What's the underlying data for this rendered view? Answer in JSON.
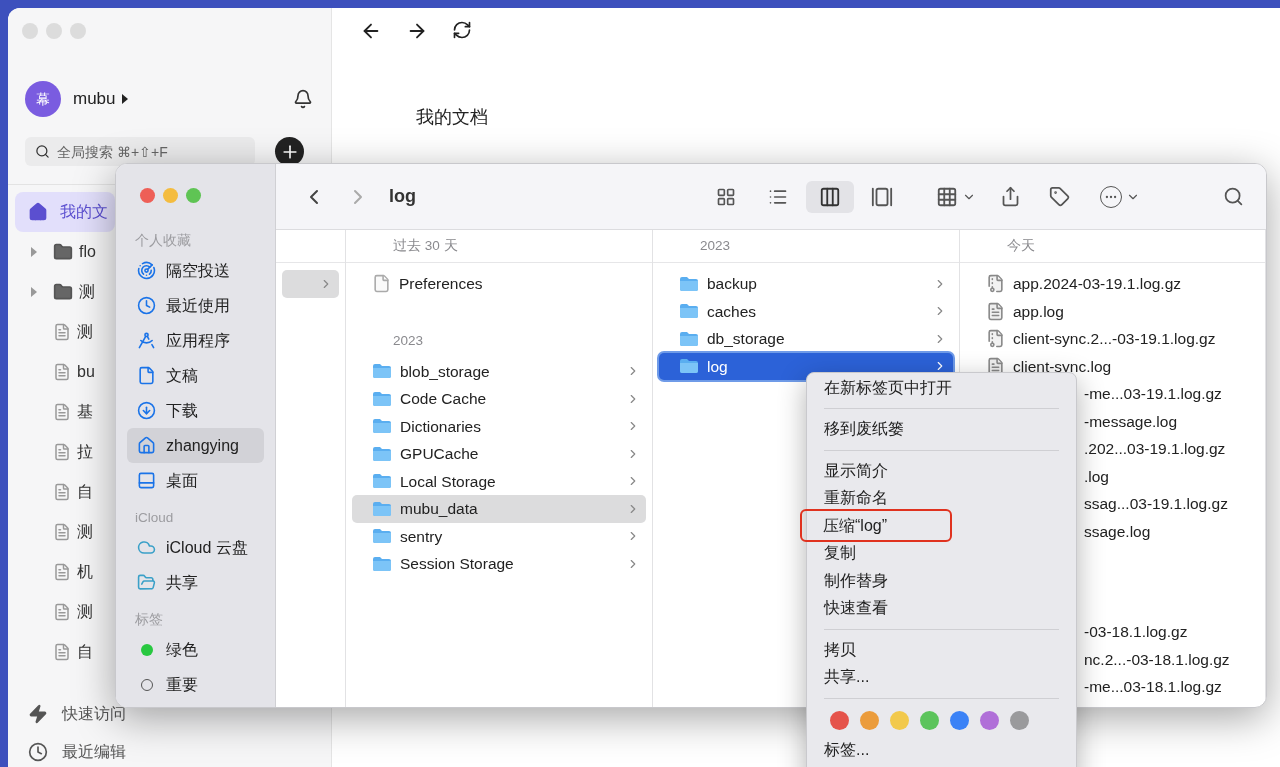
{
  "mubu": {
    "user": {
      "avatar": "幕",
      "name": "mubu"
    },
    "search": {
      "placeholder": "全局搜索 ⌘+⇧+F"
    },
    "sidebar": [
      {
        "label": "我的文",
        "kind": "home",
        "selected": true
      },
      {
        "label": "flo",
        "kind": "folder",
        "selected": false
      },
      {
        "label": "测",
        "kind": "folder",
        "selected": false
      },
      {
        "label": "测",
        "kind": "doc",
        "selected": false
      },
      {
        "label": "bu",
        "kind": "doc",
        "selected": false
      },
      {
        "label": "基",
        "kind": "doc",
        "selected": false
      },
      {
        "label": "拉",
        "kind": "doc",
        "selected": false
      },
      {
        "label": "自",
        "kind": "doc",
        "selected": false
      },
      {
        "label": "测",
        "kind": "doc",
        "selected": false
      },
      {
        "label": "机",
        "kind": "doc",
        "selected": false
      },
      {
        "label": "测",
        "kind": "doc",
        "selected": false
      },
      {
        "label": "自",
        "kind": "doc",
        "selected": false
      }
    ],
    "links": [
      {
        "label": "快速访问",
        "kind": "bolt"
      },
      {
        "label": "最近编辑",
        "kind": "clock"
      }
    ],
    "page_title": "我的文档"
  },
  "finder": {
    "title": "log",
    "view_modes": [
      {
        "kind": "icons",
        "selected": false
      },
      {
        "kind": "list",
        "selected": false
      },
      {
        "kind": "columns",
        "selected": true
      },
      {
        "kind": "gallery",
        "selected": false
      }
    ],
    "sidebar": [
      {
        "heading": "个人收藏",
        "items": [
          {
            "label": "隔空投送",
            "kind": "airdrop",
            "selected": false
          },
          {
            "label": "最近使用",
            "kind": "recents",
            "selected": false
          },
          {
            "label": "应用程序",
            "kind": "apps",
            "selected": false
          },
          {
            "label": "文稿",
            "kind": "documents",
            "selected": false
          },
          {
            "label": "下载",
            "kind": "downloads",
            "selected": false
          },
          {
            "label": "zhangying",
            "kind": "home",
            "selected": true
          },
          {
            "label": "桌面",
            "kind": "desktop",
            "selected": false
          }
        ]
      },
      {
        "heading": "iCloud",
        "items": [
          {
            "label": "iCloud 云盘",
            "kind": "cloud",
            "selected": false
          },
          {
            "label": "共享",
            "kind": "shared",
            "selected": false
          }
        ]
      },
      {
        "heading": "标签",
        "items": [
          {
            "label": "绿色",
            "kind": "tag",
            "color": "#28c840",
            "selected": false
          },
          {
            "label": "重要",
            "kind": "tag_empty",
            "selected": false
          }
        ]
      }
    ],
    "columns": [
      {
        "focused": false,
        "groups": [
          {
            "rows": [
              {
                "kind": "hidden",
                "selected": true,
                "chevron": true
              }
            ]
          }
        ]
      },
      {
        "header": "过去 30 天",
        "focused": false,
        "groups": [
          {
            "rows": [
              {
                "label": "Preferences",
                "kind": "document",
                "selected": false,
                "chevron": false
              }
            ]
          },
          {
            "header": "2023",
            "rows": [
              {
                "label": "blob_storage",
                "kind": "folder",
                "selected": false,
                "chevron": true
              },
              {
                "label": "Code Cache",
                "kind": "folder",
                "selected": false,
                "chevron": true
              },
              {
                "label": "Dictionaries",
                "kind": "folder",
                "selected": false,
                "chevron": true
              },
              {
                "label": "GPUCache",
                "kind": "folder",
                "selected": false,
                "chevron": true
              },
              {
                "label": "Local Storage",
                "kind": "folder",
                "selected": false,
                "chevron": true
              },
              {
                "label": "mubu_data",
                "kind": "folder",
                "selected": true,
                "chevron": true
              },
              {
                "label": "sentry",
                "kind": "folder",
                "selected": false,
                "chevron": true
              },
              {
                "label": "Session Storage",
                "kind": "folder",
                "selected": false,
                "chevron": true
              }
            ]
          }
        ]
      },
      {
        "header": "2023",
        "focused": true,
        "groups": [
          {
            "rows": [
              {
                "label": "backup",
                "kind": "folder",
                "selected": false,
                "chevron": true
              },
              {
                "label": "caches",
                "kind": "folder",
                "selected": false,
                "chevron": true
              },
              {
                "label": "db_storage",
                "kind": "folder",
                "selected": false,
                "chevron": true
              },
              {
                "label": "log",
                "kind": "folder",
                "selected": true,
                "chevron": true
              }
            ]
          }
        ]
      },
      {
        "header": "今天",
        "groups": [
          {
            "rows": [
              {
                "label": "app.2024-03-19.1.log.gz",
                "kind": "archive",
                "selected": false,
                "chevron": false
              },
              {
                "label": "app.log",
                "kind": "log",
                "selected": false,
                "chevron": false
              },
              {
                "label": "client-sync.2...-03-19.1.log.gz",
                "kind": "archive",
                "selected": false,
                "chevron": false
              },
              {
                "label": "client-sync.log",
                "kind": "log",
                "selected": false,
                "chevron": false
              },
              {
                "label": "-me...03-19.1.log.gz",
                "kind": "fragment",
                "selected": false,
                "chevron": false
              },
              {
                "label": "-message.log",
                "kind": "fragment",
                "selected": false,
                "chevron": false
              },
              {
                "label": ".202...03-19.1.log.gz",
                "kind": "fragment",
                "selected": false,
                "chevron": false
              },
              {
                "label": ".log",
                "kind": "fragment",
                "selected": false,
                "chevron": false
              },
              {
                "label": "ssag...03-19.1.log.gz",
                "kind": "fragment",
                "selected": false,
                "chevron": false
              },
              {
                "label": "ssage.log",
                "kind": "fragment",
                "selected": false,
                "chevron": false
              }
            ]
          },
          {
            "rows": [
              {
                "label": "-03-18.1.log.gz",
                "kind": "fragment",
                "selected": false,
                "chevron": false
              },
              {
                "label": "nc.2...-03-18.1.log.gz",
                "kind": "fragment",
                "selected": false,
                "chevron": false
              },
              {
                "label": "-me...03-18.1.log.gz",
                "kind": "fragment",
                "selected": false,
                "chevron": false
              }
            ]
          }
        ]
      }
    ]
  },
  "context_menu": {
    "groups": [
      {
        "items": [
          {
            "label": "在新标签页中打开",
            "highlighted": false
          }
        ]
      },
      {
        "items": [
          {
            "label": "移到废纸篓",
            "highlighted": false
          }
        ]
      },
      {
        "items": [
          {
            "label": "显示简介",
            "highlighted": false
          },
          {
            "label": "重新命名",
            "highlighted": false
          },
          {
            "label": "压缩“log”",
            "highlighted": true
          },
          {
            "label": "复制",
            "highlighted": false
          },
          {
            "label": "制作替身",
            "highlighted": false
          },
          {
            "label": "快速查看",
            "highlighted": false
          }
        ]
      },
      {
        "items": [
          {
            "label": "拷贝",
            "highlighted": false
          },
          {
            "label": "共享...",
            "highlighted": false
          }
        ]
      }
    ],
    "tag_colors": [
      {
        "color": "#e5534b"
      },
      {
        "color": "#eb9c3c"
      },
      {
        "color": "#f2c94c"
      },
      {
        "color": "#5cc45c"
      },
      {
        "color": "#3b82f6"
      },
      {
        "color": "#b06fd8"
      },
      {
        "color": "#9a9a9c"
      }
    ],
    "tags_item": {
      "label": "标签..."
    }
  }
}
